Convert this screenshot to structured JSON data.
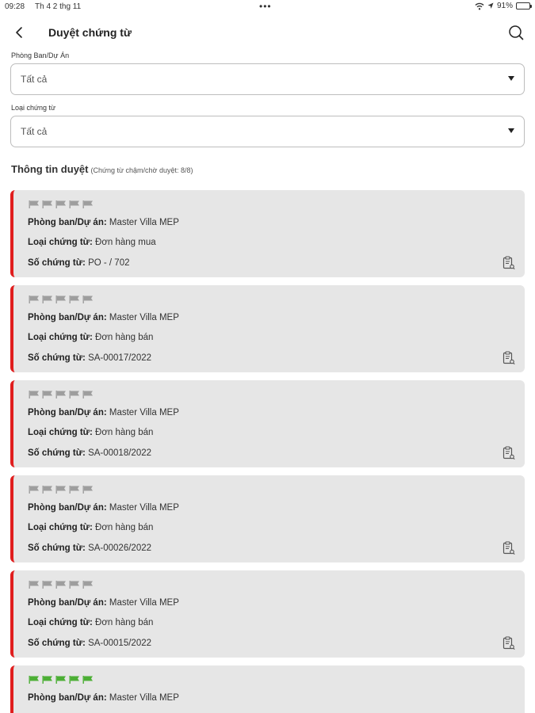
{
  "status_bar": {
    "time": "09:28",
    "date": "Th 4 2 thg 11",
    "dots": "•••",
    "battery_text": "91%",
    "battery_level": 0.91
  },
  "header": {
    "title": "Duyệt chứng từ",
    "back_icon": "chevron-left-icon",
    "search_icon": "search-icon"
  },
  "filters": {
    "department": {
      "label": "Phòng Ban/Dự Án",
      "value": "Tất cả"
    },
    "doc_type": {
      "label": "Loại chứng từ",
      "value": "Tất cả"
    }
  },
  "section": {
    "title": "Thông tin duyệt",
    "subtitle": "(Chứng từ chậm/chờ duyệt: 8/8)"
  },
  "labels": {
    "department": "Phòng ban/Dự án:",
    "doc_type": "Loại chứng từ:",
    "doc_number": "Số chứng từ:"
  },
  "colors": {
    "accent_bar": "#e01e1e",
    "flag_gray": "#9e9e9e",
    "flag_green": "#4caf35",
    "card_bg": "#e6e6e6"
  },
  "cards": [
    {
      "flag_color": "gray",
      "flag_count": 5,
      "department": "Master Villa MEP",
      "doc_type": "Đơn hàng mua",
      "doc_number": "PO - / 702"
    },
    {
      "flag_color": "gray",
      "flag_count": 5,
      "department": "Master Villa MEP",
      "doc_type": "Đơn hàng bán",
      "doc_number": "SA-00017/2022"
    },
    {
      "flag_color": "gray",
      "flag_count": 5,
      "department": "Master Villa MEP",
      "doc_type": "Đơn hàng bán",
      "doc_number": "SA-00018/2022"
    },
    {
      "flag_color": "gray",
      "flag_count": 5,
      "department": "Master Villa MEP",
      "doc_type": "Đơn hàng bán",
      "doc_number": "SA-00026/2022"
    },
    {
      "flag_color": "gray",
      "flag_count": 5,
      "department": "Master Villa MEP",
      "doc_type": "Đơn hàng bán",
      "doc_number": "SA-00015/2022"
    },
    {
      "flag_color": "green",
      "flag_count": 5,
      "department": "Master Villa MEP"
    }
  ]
}
